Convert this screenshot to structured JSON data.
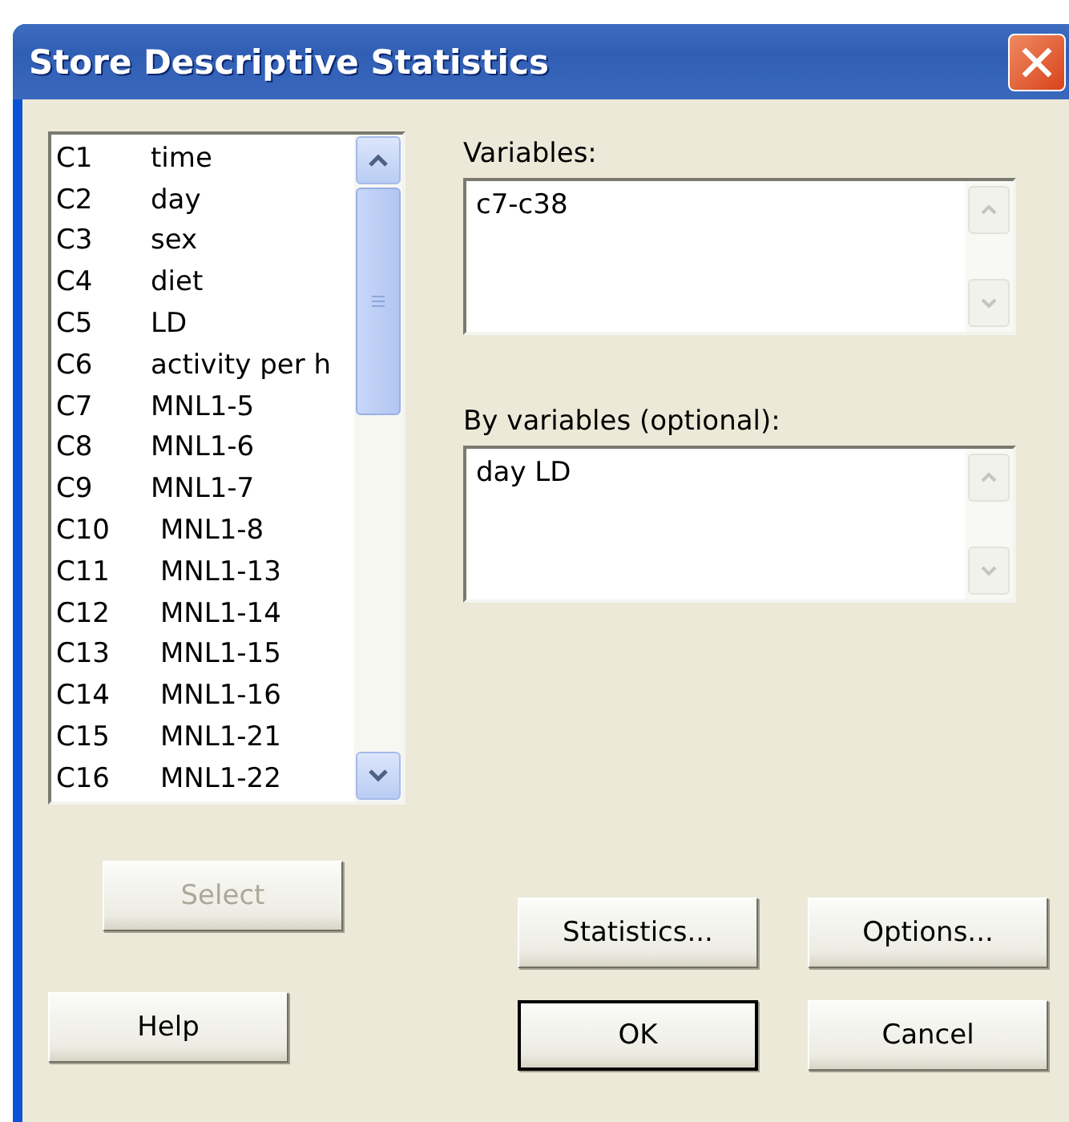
{
  "window": {
    "title": "Store Descriptive Statistics"
  },
  "column_list": [
    {
      "code": "C1",
      "name": "time"
    },
    {
      "code": "C2",
      "name": "day"
    },
    {
      "code": "C3",
      "name": "sex"
    },
    {
      "code": "C4",
      "name": "diet"
    },
    {
      "code": "C5",
      "name": "LD"
    },
    {
      "code": "C6",
      "name": "activity per h"
    },
    {
      "code": "C7",
      "name": "MNL1-5"
    },
    {
      "code": "C8",
      "name": "MNL1-6"
    },
    {
      "code": "C9",
      "name": "MNL1-7"
    },
    {
      "code": "C10",
      "name": "MNL1-8"
    },
    {
      "code": "C11",
      "name": "MNL1-13"
    },
    {
      "code": "C12",
      "name": "MNL1-14"
    },
    {
      "code": "C13",
      "name": "MNL1-15"
    },
    {
      "code": "C14",
      "name": "MNL1-16"
    },
    {
      "code": "C15",
      "name": "MNL1-21"
    },
    {
      "code": "C16",
      "name": "MNL1-22"
    }
  ],
  "fields": [
    {
      "label": "Variables:",
      "value": "c7-c38"
    },
    {
      "label": "By variables (optional):",
      "value": "day LD"
    }
  ],
  "buttons": {
    "select": {
      "label": "Select",
      "disabled": true
    },
    "statistics": {
      "label": "Statistics..."
    },
    "options": {
      "label": "Options..."
    },
    "help": {
      "label": "Help"
    },
    "ok": {
      "label": "OK",
      "default": true
    },
    "cancel": {
      "label": "Cancel"
    }
  }
}
